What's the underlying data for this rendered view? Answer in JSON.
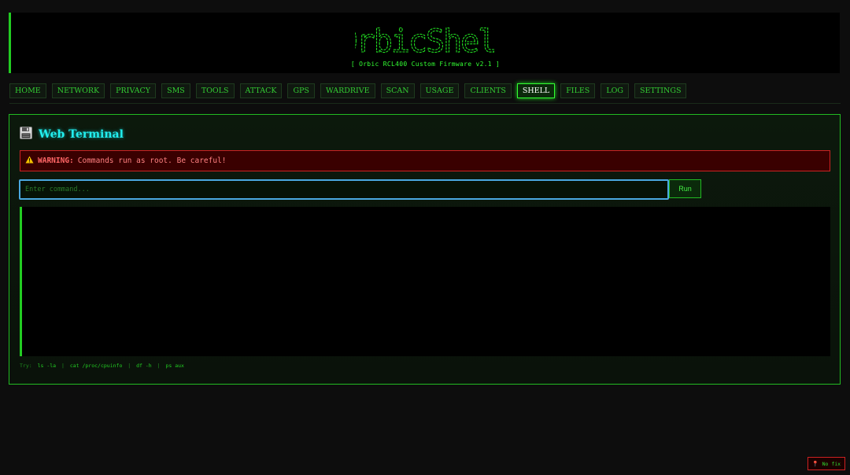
{
  "header": {
    "logo_text": "OrbicShell",
    "subtitle": "[ Orbic RCL400 Custom Firmware v2.1 ]"
  },
  "nav": {
    "items": [
      {
        "label": "HOME"
      },
      {
        "label": "NETWORK"
      },
      {
        "label": "PRIVACY"
      },
      {
        "label": "SMS"
      },
      {
        "label": "TOOLS"
      },
      {
        "label": "ATTACK"
      },
      {
        "label": "GPS"
      },
      {
        "label": "WARDRIVE"
      },
      {
        "label": "SCAN"
      },
      {
        "label": "USAGE"
      },
      {
        "label": "CLIENTS"
      },
      {
        "label": "SHELL",
        "active": true
      },
      {
        "label": "FILES"
      },
      {
        "label": "LOG"
      },
      {
        "label": "SETTINGS"
      }
    ]
  },
  "panel": {
    "icon": "floppy-disk-icon",
    "title": "Web Terminal",
    "warning": {
      "icon": "warning-triangle-icon",
      "label": "WARNING:",
      "message": "Commands run as root. Be careful!"
    },
    "command": {
      "placeholder": "Enter command...",
      "value": "",
      "run_label": "Run"
    },
    "hints": {
      "prefix": "Try:",
      "commands": [
        "ls -la",
        "cat /proc/cpuinfo",
        "df -h",
        "ps aux"
      ]
    }
  },
  "status": {
    "gps_icon": "pin-icon",
    "gps_text": "No fix"
  },
  "colors": {
    "accent": "#33dd33",
    "title": "#22eeee",
    "warning": "#ff6666",
    "input_focus": "#4aa8e0"
  }
}
